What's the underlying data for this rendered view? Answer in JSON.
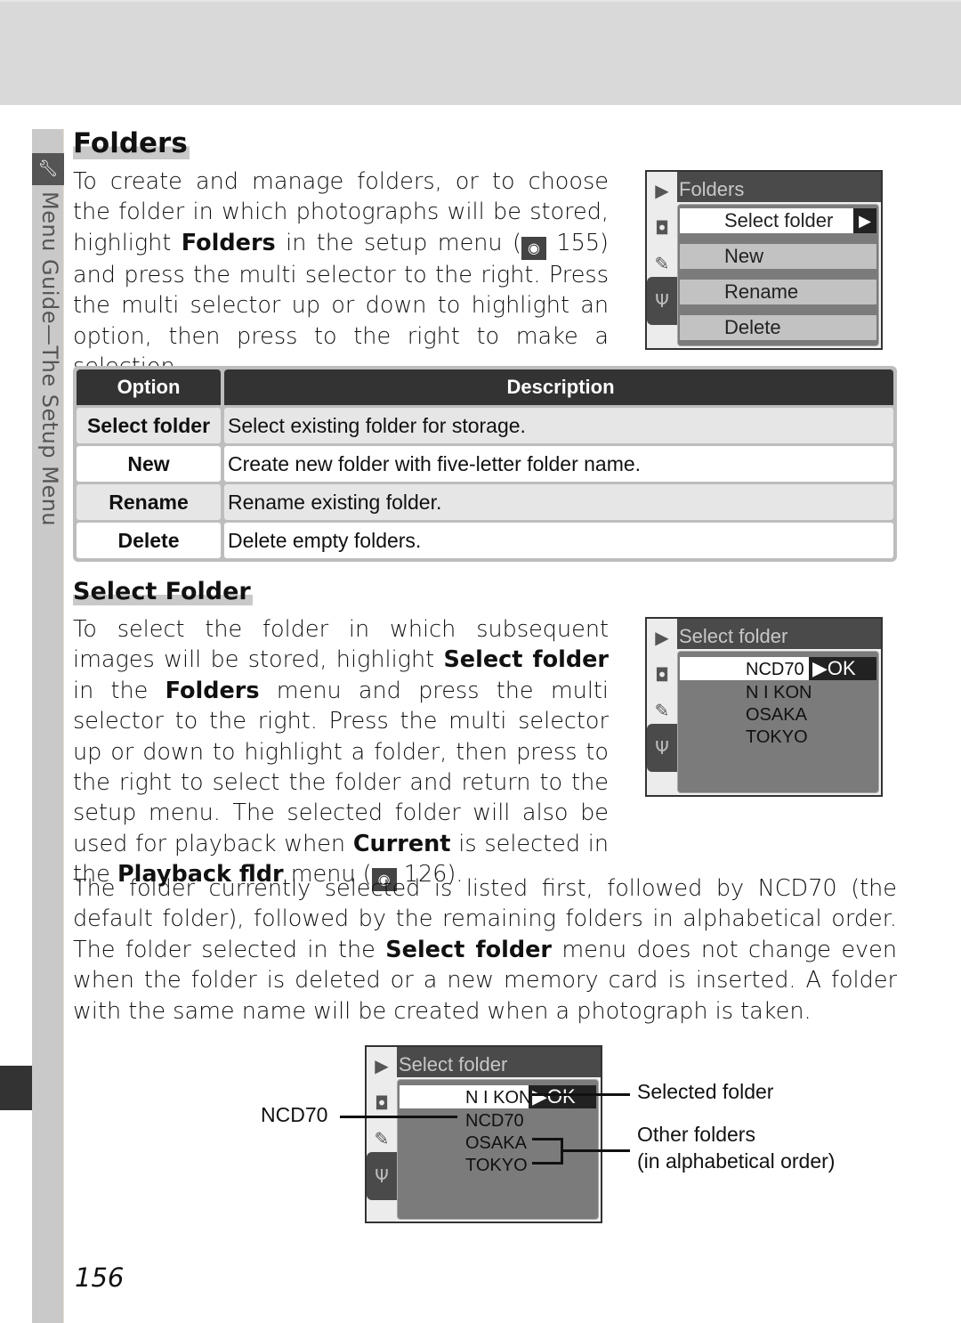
{
  "sidebar": {
    "section_label": "Menu Guide—The Setup Menu",
    "icon": "wrench-icon"
  },
  "folders_section": {
    "heading": "Folders",
    "paragraph": {
      "t1": "To create and manage folders, or to choose the folder in which photographs will be stored, highlight ",
      "b1": "Folders",
      "t2": " in the setup menu (",
      "ref_icon": "eye-reference-icon",
      "t3": " 155) and press the multi selector to the right.  Press the multi selector up or down to highlight an option, then press to the right to make a selection."
    },
    "screen": {
      "title": "Folders",
      "items": [
        "Select folder",
        "New",
        "Rename",
        "Delete"
      ],
      "highlighted_index": 0
    },
    "table": {
      "headers": [
        "Option",
        "Description"
      ],
      "rows": [
        {
          "option": "Select folder",
          "description": "Select existing folder for storage."
        },
        {
          "option": "New",
          "description": "Create new folder with five-letter folder name."
        },
        {
          "option": "Rename",
          "description": "Rename existing folder."
        },
        {
          "option": "Delete",
          "description": "Delete empty folders."
        }
      ]
    }
  },
  "select_folder_section": {
    "heading": "Select Folder",
    "paragraph": {
      "t1": "To select the folder in which subsequent images will be stored, highlight ",
      "b1": "Select folder",
      "t2": " in the ",
      "b2": "Folders",
      "t3": " menu and press the multi selector to the right.  Press the multi selector up or down to highlight a folder, then press to the right to select the folder and return to the setup menu.  The selected folder will also be used for playback when ",
      "b3": "Current",
      "t4": " is selected in the ",
      "b4": "Playback fldr",
      "t5": " menu (",
      "t6": " 126)."
    },
    "screen": {
      "title": "Select folder",
      "folders": [
        "NCD70",
        "N I KON",
        "OSAKA",
        "TOKYO"
      ],
      "ok_label": "▶OK"
    },
    "paragraph2": {
      "t1": "The folder currently selected is listed first, followed by NCD70 (the default folder), followed by the remaining folders in alphabetical order.  The folder selected in the ",
      "b1": "Select folder",
      "t2": " menu does not change even when the folder is deleted or a new memory card is inserted.  A folder with the same name will be created when a photograph is taken."
    },
    "diagram": {
      "title": "Select folder",
      "folders": [
        "N I KON",
        "NCD70",
        "OSAKA",
        "TOKYO"
      ],
      "ok_label": "▶OK",
      "callouts": {
        "left": "NCD70",
        "selected": "Selected folder",
        "others_line1": "Other folders",
        "others_line2": "(in alphabetical order)"
      }
    }
  },
  "page_number": "156",
  "tab_icons": [
    "playback-icon",
    "camera-icon",
    "pencil-icon",
    "wrench-icon"
  ]
}
